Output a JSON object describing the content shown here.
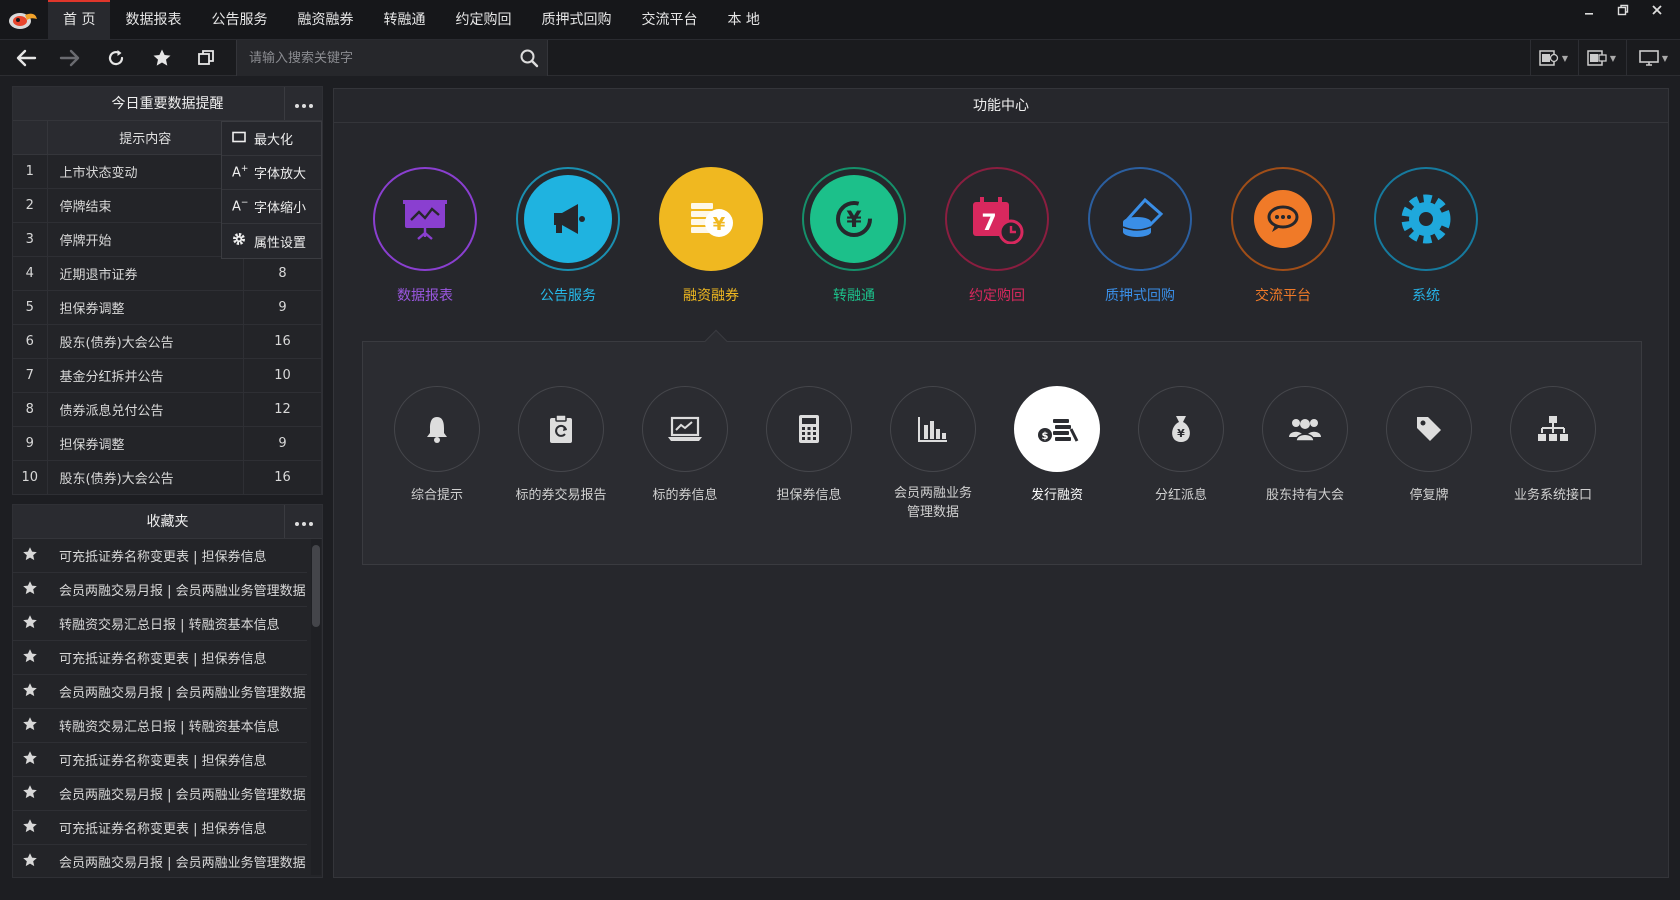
{
  "menubar": {
    "items": [
      "首 页",
      "数据报表",
      "公告服务",
      "融资融券",
      "转融通",
      "约定购回",
      "质押式回购",
      "交流平台",
      "本 地"
    ],
    "active_index": 0,
    "accent_color": "#e0362b"
  },
  "toolbar": {
    "search_placeholder": "请输入搜索关键字"
  },
  "alerts": {
    "title": "今日重要数据提醒",
    "column_header": "提示内容",
    "rows": [
      {
        "index": "1",
        "name": "上市状态变动",
        "count": ""
      },
      {
        "index": "2",
        "name": "停牌结束",
        "count": ""
      },
      {
        "index": "3",
        "name": "停牌开始",
        "count": ""
      },
      {
        "index": "4",
        "name": "近期退市证券",
        "count": "8"
      },
      {
        "index": "5",
        "name": "担保券调整",
        "count": "9"
      },
      {
        "index": "6",
        "name": "股东(债券)大会公告",
        "count": "16"
      },
      {
        "index": "7",
        "name": "基金分红拆并公告",
        "count": "10"
      },
      {
        "index": "8",
        "name": "债券派息兑付公告",
        "count": "12"
      },
      {
        "index": "9",
        "name": "担保券调整",
        "count": "9"
      },
      {
        "index": "10",
        "name": "股东(债券)大会公告",
        "count": "16"
      }
    ],
    "context_menu": [
      "最大化",
      "字体放大",
      "字体缩小",
      "属性设置"
    ]
  },
  "favorites": {
    "title": "收藏夹",
    "items": [
      "可充抵证券名称变更表 | 担保券信息",
      "会员两融交易月报 | 会员两融业务管理数据",
      "转融资交易汇总日报 | 转融资基本信息",
      "可充抵证券名称变更表 | 担保券信息",
      "会员两融交易月报 | 会员两融业务管理数据",
      "转融资交易汇总日报 | 转融资基本信息",
      "可充抵证券名称变更表 | 担保券信息",
      "会员两融交易月报 | 会员两融业务管理数据",
      "可充抵证券名称变更表 | 担保券信息",
      "会员两融交易月报 | 会员两融业务管理数据"
    ]
  },
  "function_center": {
    "title": "功能中心",
    "categories": [
      {
        "label": "数据报表",
        "color": "#8a3fd0",
        "icon": "presentation-chart-icon"
      },
      {
        "label": "公告服务",
        "color": "#1fb3e0",
        "icon": "megaphone-icon"
      },
      {
        "label": "融资融券",
        "color": "#f0b820",
        "icon": "coins-yen-icon"
      },
      {
        "label": "转融通",
        "color": "#1cc08a",
        "icon": "yen-cycle-icon"
      },
      {
        "label": "约定购回",
        "color": "#d8285e",
        "icon": "calendar-clock-icon"
      },
      {
        "label": "质押式回购",
        "color": "#3a8ee6",
        "icon": "coin-stack-icon"
      },
      {
        "label": "交流平台",
        "color": "#f07a28",
        "icon": "chat-bubble-icon"
      },
      {
        "label": "系统",
        "color": "#1fa8dc",
        "icon": "gear-icon"
      }
    ],
    "selected_category": 2,
    "subitems": [
      {
        "label": "综合提示",
        "icon": "bell-icon"
      },
      {
        "label": "标的券交易报告",
        "icon": "clipboard-refresh-icon"
      },
      {
        "label": "标的券信息",
        "icon": "laptop-chart-icon"
      },
      {
        "label": "担保券信息",
        "icon": "calculator-icon"
      },
      {
        "label": "会员两融业务管理数据",
        "icon": "bar-chart-icon"
      },
      {
        "label": "发行融资",
        "icon": "coins-dollar-icon"
      },
      {
        "label": "分红派息",
        "icon": "money-bag-icon"
      },
      {
        "label": "股东持有大会",
        "icon": "users-group-icon"
      },
      {
        "label": "停复牌",
        "icon": "tag-icon"
      },
      {
        "label": "业务系统接口",
        "icon": "org-chart-icon"
      }
    ],
    "selected_subitem": 5
  }
}
